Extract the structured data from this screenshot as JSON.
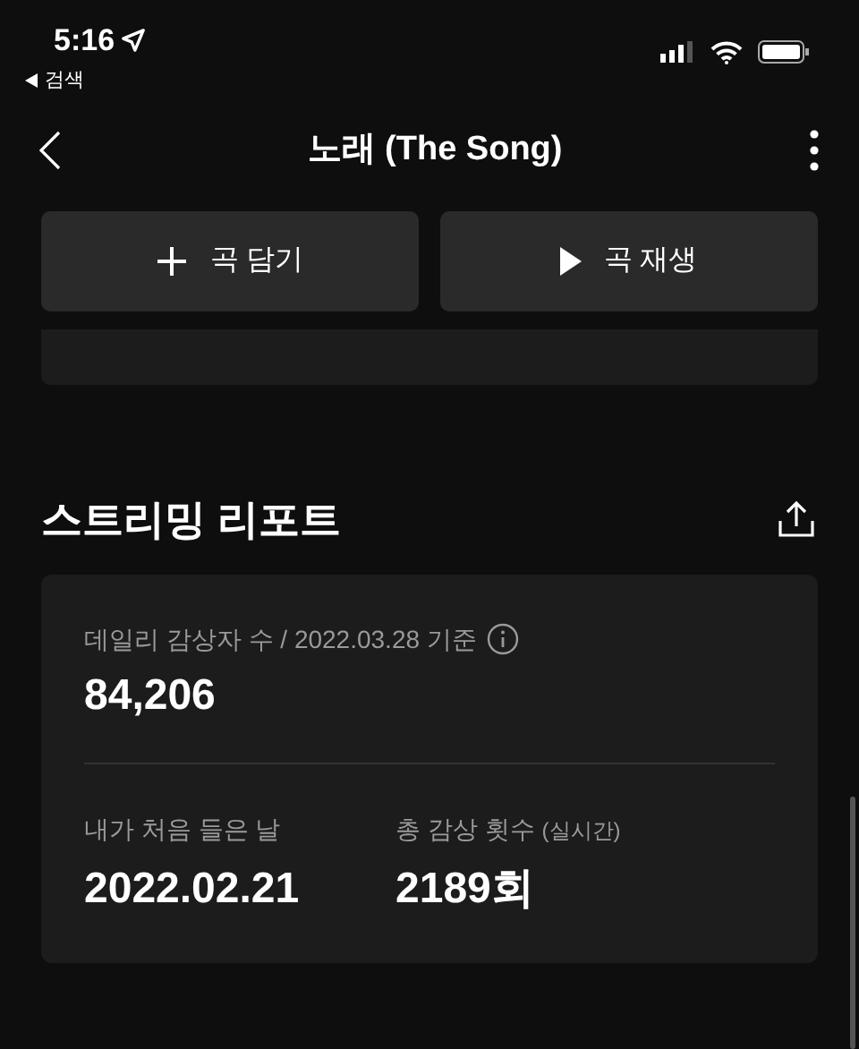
{
  "status_bar": {
    "time": "5:16",
    "back_label": "검색"
  },
  "nav": {
    "title": "노래 (The Song)"
  },
  "buttons": [
    {
      "kind": "add",
      "label": "곡 담기"
    },
    {
      "kind": "play",
      "label": "곡 재생"
    }
  ],
  "report": {
    "title": "스트리밍 리포트",
    "daily_label": "데일리 감상자 수 / 2022.03.28 기준",
    "daily_value": "84,206",
    "stats": [
      {
        "label": "내가 처음 들은 날",
        "value": "2022.02.21"
      },
      {
        "label": "총 감상 횟수",
        "note": "(실시간)",
        "value": "2189회"
      }
    ]
  }
}
